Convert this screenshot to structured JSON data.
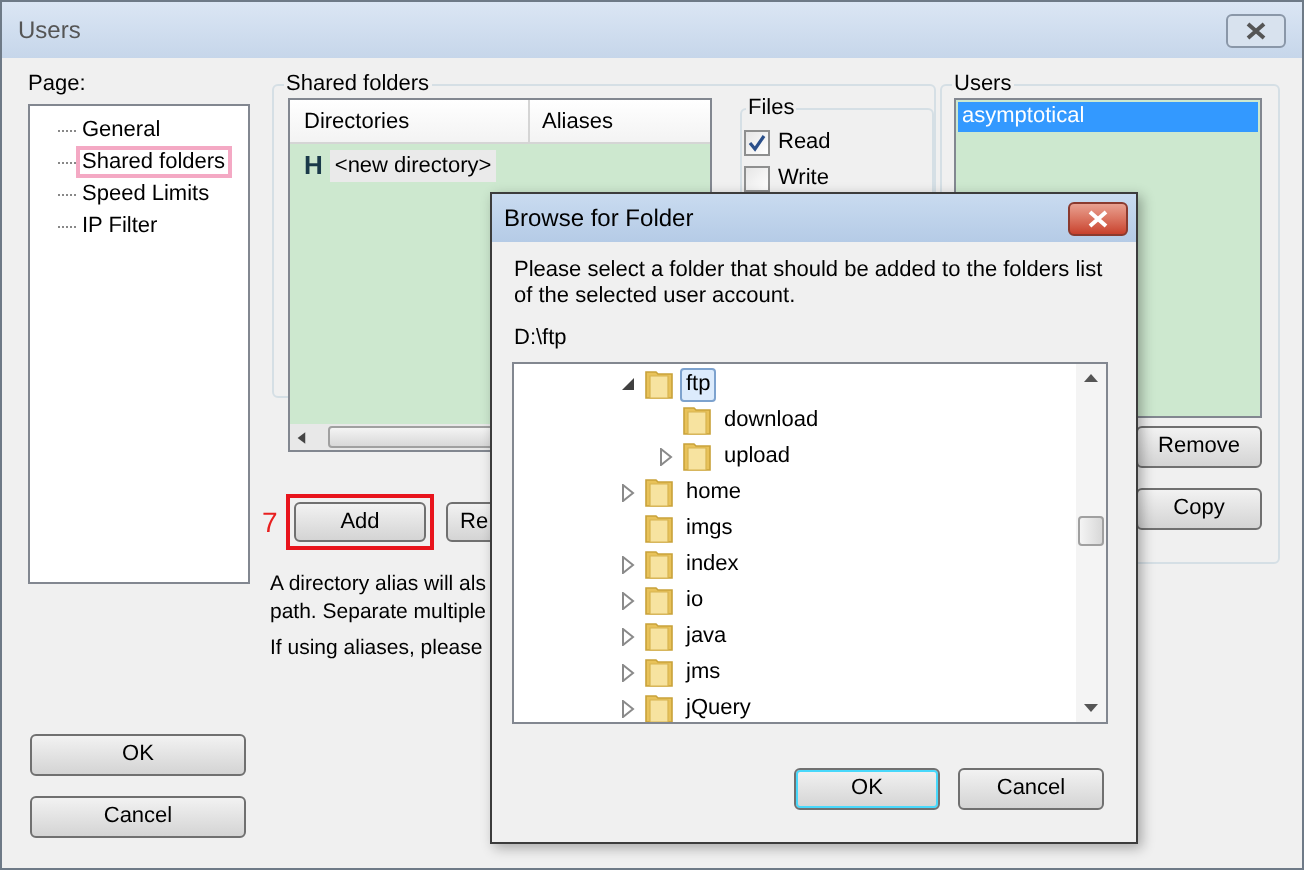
{
  "window": {
    "title": "Users"
  },
  "page_tree": {
    "label": "Page:",
    "items": [
      {
        "label": "General",
        "selected": false
      },
      {
        "label": "Shared folders",
        "selected": true
      },
      {
        "label": "Speed Limits",
        "selected": false
      },
      {
        "label": "IP Filter",
        "selected": false
      }
    ]
  },
  "shared_folders": {
    "title": "Shared folders",
    "columns": [
      "Directories",
      "Aliases"
    ],
    "rows": [
      {
        "marker": "H",
        "path": "<new directory>"
      }
    ],
    "buttons": [
      {
        "label": "Add",
        "highlighted": true
      },
      {
        "label": "Re",
        "highlighted": false
      }
    ],
    "annotation": "7",
    "notes": [
      "A directory alias will als",
      "path. Separate multiple",
      "If using aliases, please"
    ]
  },
  "files": {
    "title": "Files",
    "permissions": [
      {
        "label": "Read",
        "checked": true
      },
      {
        "label": "Write",
        "checked": false
      }
    ]
  },
  "users": {
    "title": "Users",
    "items": [
      {
        "label": "asymptotical",
        "selected": true
      }
    ],
    "buttons": [
      "Remove",
      "Copy"
    ]
  },
  "footer_buttons": [
    "OK",
    "Cancel"
  ],
  "browse_dialog": {
    "title": "Browse for Folder",
    "message": "Please select a folder that should be added to the folders list of the selected user account.",
    "path": "D:\\ftp",
    "tree": [
      {
        "label": "ftp",
        "selected": true,
        "kind": "expanded",
        "children": [
          {
            "label": "download",
            "selected": false,
            "kind": "leaf"
          },
          {
            "label": "upload",
            "selected": false,
            "kind": "collapsed"
          }
        ]
      },
      {
        "label": "home",
        "selected": false,
        "kind": "collapsed"
      },
      {
        "label": "imgs",
        "selected": false,
        "kind": "leaf"
      },
      {
        "label": "index",
        "selected": false,
        "kind": "collapsed"
      },
      {
        "label": "io",
        "selected": false,
        "kind": "collapsed"
      },
      {
        "label": "java",
        "selected": false,
        "kind": "collapsed"
      },
      {
        "label": "jms",
        "selected": false,
        "kind": "collapsed"
      },
      {
        "label": "jQuery",
        "selected": false,
        "kind": "collapsed"
      }
    ],
    "buttons": [
      "OK",
      "Cancel"
    ]
  }
}
